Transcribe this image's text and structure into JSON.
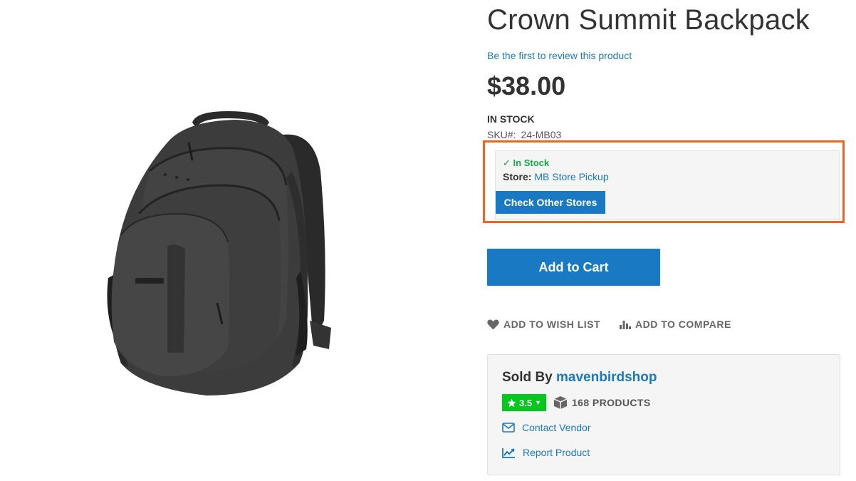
{
  "product": {
    "title": "Crown Summit Backpack",
    "review_link": "Be the first to review this product",
    "price": "$38.00",
    "stock_status": "IN STOCK",
    "sku_label": "SKU#:",
    "sku_value": "24-MB03"
  },
  "store_pickup": {
    "check_mark": "✓",
    "status": "In Stock",
    "store_label": "Store:",
    "store_name": "MB Store Pickup",
    "check_button": "Check Other Stores",
    "highlight_color": "#f26322"
  },
  "actions": {
    "add_to_cart": "Add to Cart",
    "wish_list": "ADD TO WISH LIST",
    "compare": "ADD TO COMPARE"
  },
  "vendor": {
    "sold_by_label": "Sold By",
    "name": "mavenbirdshop",
    "rating": "3.5",
    "products_count": "168 PRODUCTS",
    "contact": "Contact Vendor",
    "report": "Report Product"
  },
  "colors": {
    "accent": "#1979c3",
    "in_stock_green": "#15a74a",
    "rating_green": "#05c81f"
  },
  "icons": [
    "heart-icon",
    "compare-bars-icon",
    "star-icon",
    "box-icon",
    "envelope-icon",
    "trend-chart-icon"
  ]
}
